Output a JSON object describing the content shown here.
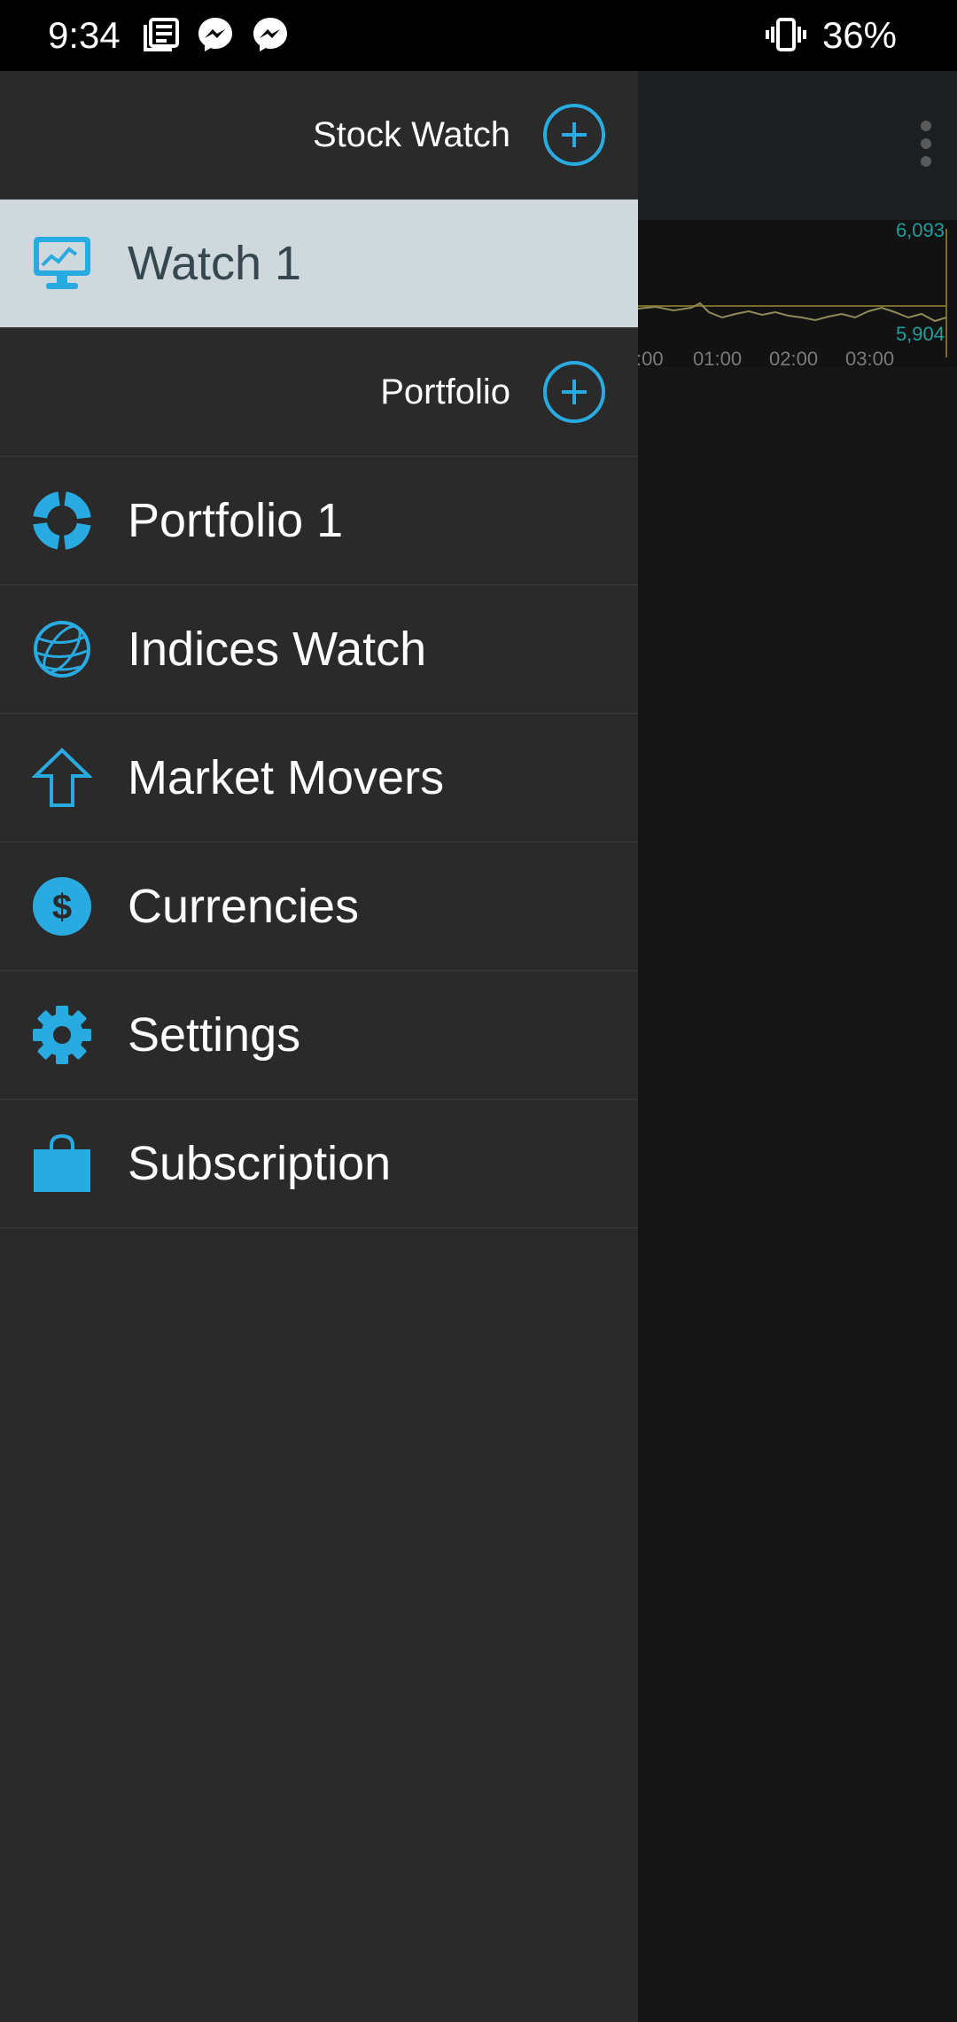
{
  "status_bar": {
    "time": "9:34",
    "battery": "36%",
    "icons": [
      "news-icon",
      "messenger-icon",
      "messenger-icon",
      "vibrate-icon"
    ]
  },
  "background_app": {
    "chart": {
      "y_max_label": "6,093",
      "y_min_label": "5,904",
      "x_labels": [
        ":00",
        "01:00",
        "02:00",
        "03:00"
      ]
    }
  },
  "drawer": {
    "stock_watch_header": {
      "label": "Stock Watch",
      "add_icon": "add-circle-icon"
    },
    "watch_1": {
      "label": "Watch 1",
      "icon": "monitor-chart-icon"
    },
    "portfolio_header": {
      "label": "Portfolio",
      "add_icon": "add-circle-icon"
    },
    "items": [
      {
        "label": "Portfolio 1",
        "icon": "donut-icon"
      },
      {
        "label": "Indices Watch",
        "icon": "globe-icon"
      },
      {
        "label": "Market Movers",
        "icon": "arrow-up-icon"
      },
      {
        "label": "Currencies",
        "icon": "dollar-icon"
      },
      {
        "label": "Settings",
        "icon": "gear-icon"
      },
      {
        "label": "Subscription",
        "icon": "shopping-bag-icon"
      }
    ]
  },
  "colors": {
    "accent": "#29abe2",
    "drawer_bg": "#2a2a2a",
    "active_bg": "#cfd8dc",
    "chart_label": "#1f9e9e",
    "chart_line": "#8f8a5a"
  }
}
